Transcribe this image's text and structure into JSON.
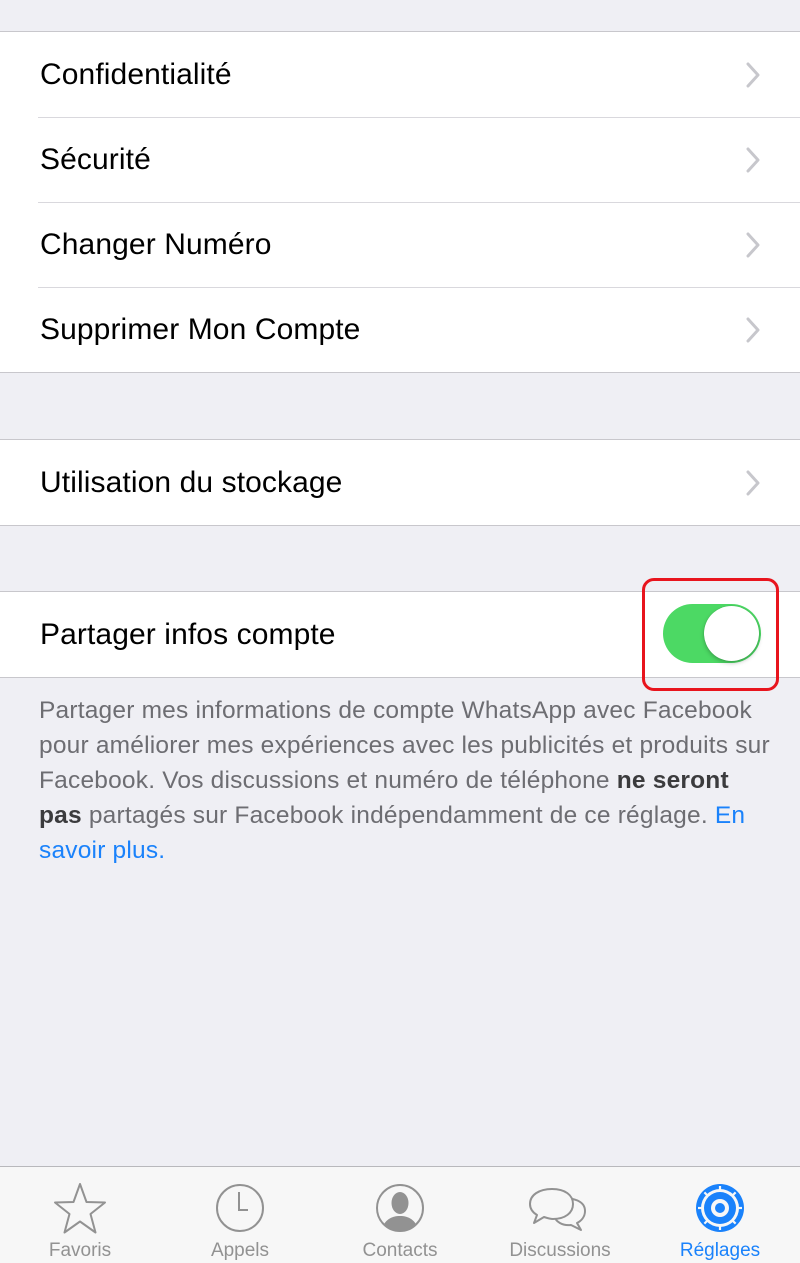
{
  "settings_group_1": {
    "rows": [
      {
        "label": "Confidentialité"
      },
      {
        "label": "Sécurité"
      },
      {
        "label": "Changer Numéro"
      },
      {
        "label": "Supprimer Mon Compte"
      }
    ]
  },
  "settings_group_2": {
    "rows": [
      {
        "label": "Utilisation du stockage"
      }
    ]
  },
  "share_setting": {
    "label": "Partager infos compte",
    "enabled": true,
    "toggle_color": "#4cd964",
    "highlight_color": "#e8141d"
  },
  "footnote": {
    "text_before": "Partager mes informations de compte WhatsApp avec Facebook pour améliorer mes expériences avec les publicités et produits sur Facebook. Vos discussions et numéro de téléphone ",
    "bold_text": "ne seront pas",
    "text_after": " partagés sur Facebook indépendamment de ce réglage. ",
    "link_text": "En savoir plus.",
    "link_color": "#1a82fb"
  },
  "tabbar": {
    "active_color": "#1a82fb",
    "tabs": [
      {
        "label": "Favoris",
        "icon": "star-icon",
        "active": false
      },
      {
        "label": "Appels",
        "icon": "clock-icon",
        "active": false
      },
      {
        "label": "Contacts",
        "icon": "person-icon",
        "active": false
      },
      {
        "label": "Discussions",
        "icon": "chat-bubbles-icon",
        "active": false
      },
      {
        "label": "Réglages",
        "icon": "gear-icon",
        "active": true
      }
    ]
  }
}
